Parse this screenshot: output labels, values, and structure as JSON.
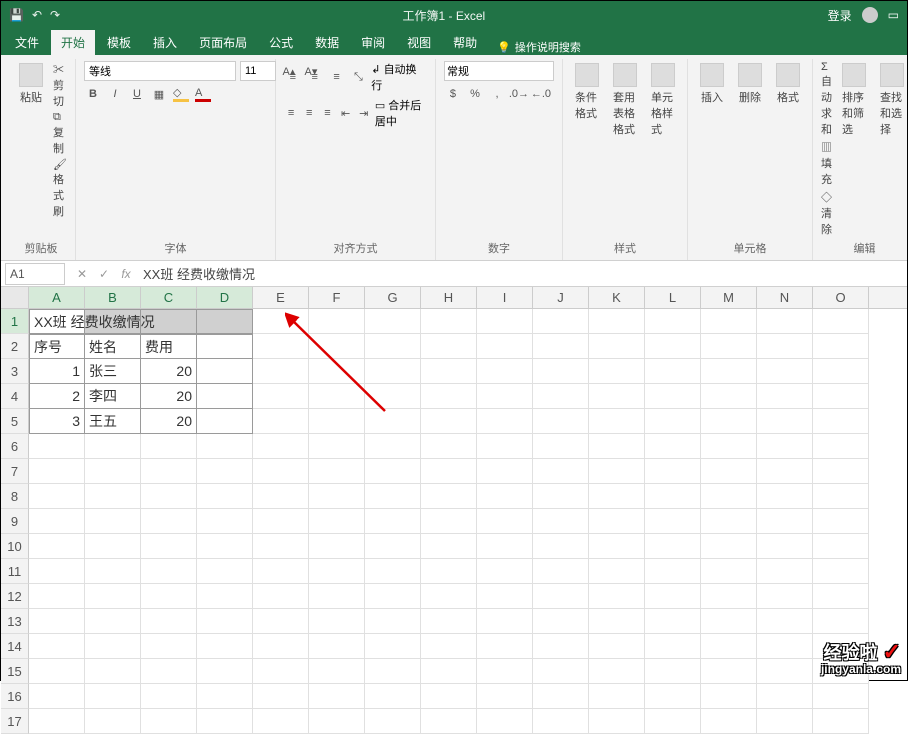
{
  "titlebar": {
    "doc_title": "工作簿1 - Excel",
    "user_label": "登录"
  },
  "tabs": {
    "file": "文件",
    "home": "开始",
    "templates": "模板",
    "insert": "插入",
    "pagelayout": "页面布局",
    "formulas": "公式",
    "data": "数据",
    "review": "审阅",
    "view": "视图",
    "help": "帮助",
    "tellme": "操作说明搜索"
  },
  "ribbon": {
    "clipboard": {
      "label": "剪贴板",
      "paste": "粘贴",
      "cut": "剪切",
      "copy": "复制",
      "format_painter": "格式刷"
    },
    "font": {
      "label": "字体",
      "name": "等线",
      "size": "11"
    },
    "alignment": {
      "label": "对齐方式",
      "wrap": "自动换行",
      "merge": "合并后居中"
    },
    "number": {
      "label": "数字",
      "format": "常规"
    },
    "styles": {
      "label": "样式",
      "cond": "条件格式",
      "table": "套用表格格式",
      "cell": "单元格样式"
    },
    "cells": {
      "label": "单元格",
      "insert": "插入",
      "delete": "删除",
      "format": "格式"
    },
    "editing": {
      "label": "编辑",
      "autosum": "自动求和",
      "fill": "填充",
      "clear": "清除",
      "sort": "排序和筛选",
      "find": "查找和选择"
    }
  },
  "formula_bar": {
    "name_box": "A1",
    "value": "XX班 经费收缴情况"
  },
  "columns": [
    "A",
    "B",
    "C",
    "D",
    "E",
    "F",
    "G",
    "H",
    "I",
    "J",
    "K",
    "L",
    "M",
    "N",
    "O"
  ],
  "rows_visible": 17,
  "table": {
    "title": "XX班 经费收缴情况",
    "headers": {
      "seq": "序号",
      "name": "姓名",
      "fee": "费用"
    },
    "rows": [
      {
        "seq": "1",
        "name": "张三",
        "fee": "20"
      },
      {
        "seq": "2",
        "name": "李四",
        "fee": "20"
      },
      {
        "seq": "3",
        "name": "王五",
        "fee": "20"
      }
    ]
  },
  "watermark": {
    "line1": "经验啦",
    "check": "✓",
    "line2": "jingyanla.com"
  }
}
